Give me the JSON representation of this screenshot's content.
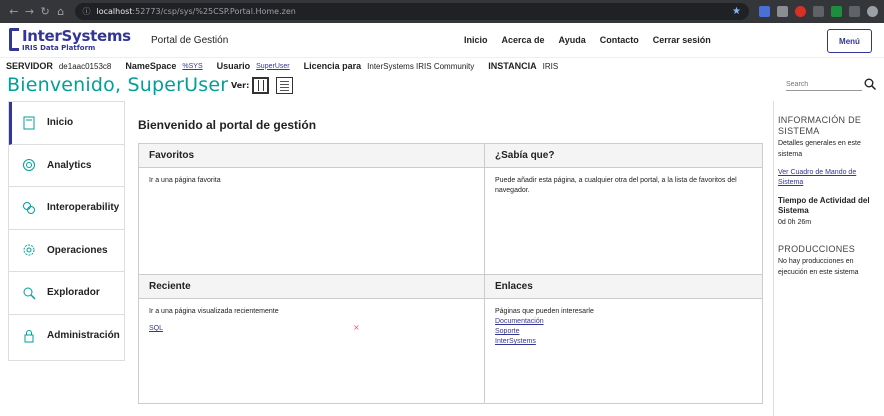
{
  "browser": {
    "url_host": "localhost",
    "url_path": ":52773/csp/sys/%25CSP.Portal.Home.zen"
  },
  "header": {
    "brand": "InterSystems",
    "brand_sub": "IRIS Data Platform",
    "portal_title": "Portal de Gestión",
    "nav": [
      "Inicio",
      "Acerca de",
      "Ayuda",
      "Contacto",
      "Cerrar sesión"
    ],
    "menu_label": "Menú"
  },
  "info": {
    "server_label": "SERVIDOR",
    "server_value": "de1aac0153c8",
    "namespace_label": "NameSpace",
    "namespace_value": "%SYS",
    "user_label": "Usuario",
    "user_value": "SuperUser",
    "license_label": "Licencia para",
    "license_value": "InterSystems IRIS Community",
    "instance_label": "INSTANCIA",
    "instance_value": "IRIS"
  },
  "welcome": {
    "title": "Bienvenido, SuperUser",
    "view_label": "Ver:",
    "search_placeholder": "Search"
  },
  "sidebar": {
    "items": [
      {
        "label": "Inicio",
        "icon": "home-icon"
      },
      {
        "label": "Analytics",
        "icon": "analytics-icon"
      },
      {
        "label": "Interoperability",
        "icon": "interoperability-icon"
      },
      {
        "label": "Operaciones",
        "icon": "gear-icon"
      },
      {
        "label": "Explorador",
        "icon": "explorer-icon"
      },
      {
        "label": "Administración",
        "icon": "lock-icon"
      }
    ]
  },
  "main": {
    "heading": "Bienvenido al portal de gestión",
    "favoritos": {
      "title": "Favoritos",
      "text": "Ir a una página favorita"
    },
    "sabia": {
      "title": "¿Sabía que?",
      "text": "Puede añadir esta página, a cualquier otra del portal, a la lista de favoritos del navegador."
    },
    "reciente": {
      "title": "Reciente",
      "text": "Ir a una página visualizada recientemente",
      "item": "SQL",
      "remove": "×"
    },
    "enlaces": {
      "title": "Enlaces",
      "text": "Páginas que pueden interesarle",
      "links": [
        "Documentación",
        "Soporte",
        "InterSystems"
      ]
    }
  },
  "right": {
    "info_title": "INFORMACIÓN DE SISTEMA",
    "info_text": "Detalles generales en este sistema",
    "dashboard_link": "Ver Cuadro de Mando de Sistema",
    "uptime_label": "Tiempo de Actividad del Sistema",
    "uptime_value": "0d 0h 26m",
    "prod_title": "PRODUCCIONES",
    "prod_text": "No hay producciones en ejecución en este sistema"
  }
}
